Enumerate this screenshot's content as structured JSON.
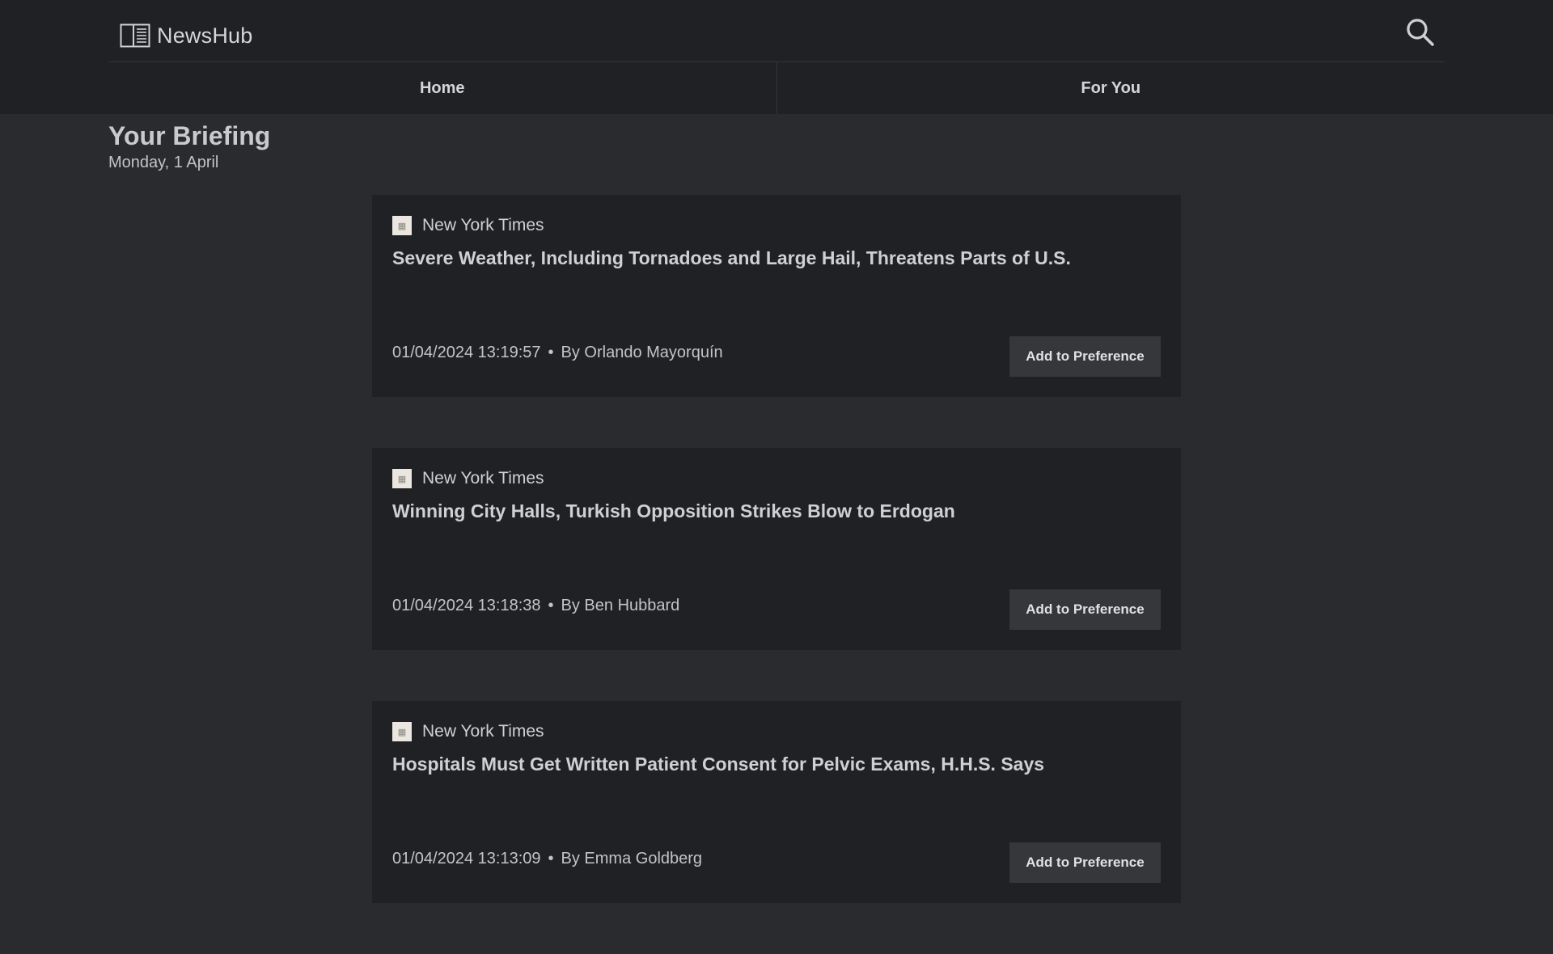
{
  "app": {
    "name": "NewsHub",
    "logo_icon": "newspaper-icon",
    "search_icon": "search-icon"
  },
  "nav": {
    "tabs": [
      {
        "label": "Home"
      },
      {
        "label": "For You"
      }
    ]
  },
  "briefing": {
    "title": "Your Briefing",
    "date": "Monday, 1 April"
  },
  "articles": [
    {
      "source": "New York Times",
      "headline": "Severe Weather, Including Tornadoes and Large Hail, Threatens Parts of U.S.",
      "timestamp": "01/04/2024 13:19:57",
      "separator": "•",
      "byline": "By Orlando Mayorquín",
      "button_label": "Add to Preference"
    },
    {
      "source": "New York Times",
      "headline": "Winning City Halls, Turkish Opposition Strikes Blow to Erdogan",
      "timestamp": "01/04/2024 13:18:38",
      "separator": "•",
      "byline": "By Ben Hubbard",
      "button_label": "Add to Preference"
    },
    {
      "source": "New York Times",
      "headline": "Hospitals Must Get Written Patient Consent for Pelvic Exams, H.H.S. Says",
      "timestamp": "01/04/2024 13:13:09",
      "separator": "•",
      "byline": "By Emma Goldberg",
      "button_label": "Add to Preference"
    }
  ],
  "colors": {
    "page_bg": "#2a2b2f",
    "header_bg": "#202124",
    "card_bg": "#202124",
    "button_bg": "#36373b",
    "text": "#cfd0d3"
  }
}
